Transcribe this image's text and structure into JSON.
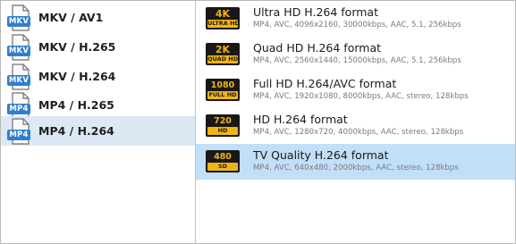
{
  "formats": [
    {
      "tag": "MKV",
      "label": "MKV / AV1"
    },
    {
      "tag": "MKV",
      "label": "MKV / H.265"
    },
    {
      "tag": "MKV",
      "label": "MKV / H.264"
    },
    {
      "tag": "MP4",
      "label": "MP4 / H.265"
    },
    {
      "tag": "MP4",
      "label": "MP4 / H.264"
    }
  ],
  "presets": [
    {
      "badge_res": "4K",
      "badge_sub": "ULTRA HD",
      "title": "Ultra HD H.264 format",
      "desc": "MP4, AVC, 4096x2160, 30000kbps, AAC, 5.1, 256kbps"
    },
    {
      "badge_res": "2K",
      "badge_sub": "QUAD HD",
      "title": "Quad HD H.264 format",
      "desc": "MP4, AVC, 2560x1440, 15000kbps, AAC, 5.1, 256kbps"
    },
    {
      "badge_res": "1080",
      "badge_sub": "FULL HD",
      "title": "Full HD H.264/AVC format",
      "desc": "MP4, AVC, 1920x1080, 8000kbps, AAC, stereo, 128kbps"
    },
    {
      "badge_res": "720",
      "badge_sub": "HD",
      "title": "HD H.264 format",
      "desc": "MP4, AVC, 1280x720, 4000kbps, AAC, stereo, 128kbps"
    },
    {
      "badge_res": "480",
      "badge_sub": "SD",
      "title": "TV Quality H.264 format",
      "desc": "MP4, AVC, 640x480, 2000kbps, AAC, stereo, 128kbps"
    }
  ],
  "colors": {
    "format_tag": "#2f7fd1",
    "selected_format_bg": "#dce9f5",
    "selected_preset_bg": "#c2dff8",
    "badge_bg": "#181818",
    "badge_gold": "#f1b415"
  }
}
